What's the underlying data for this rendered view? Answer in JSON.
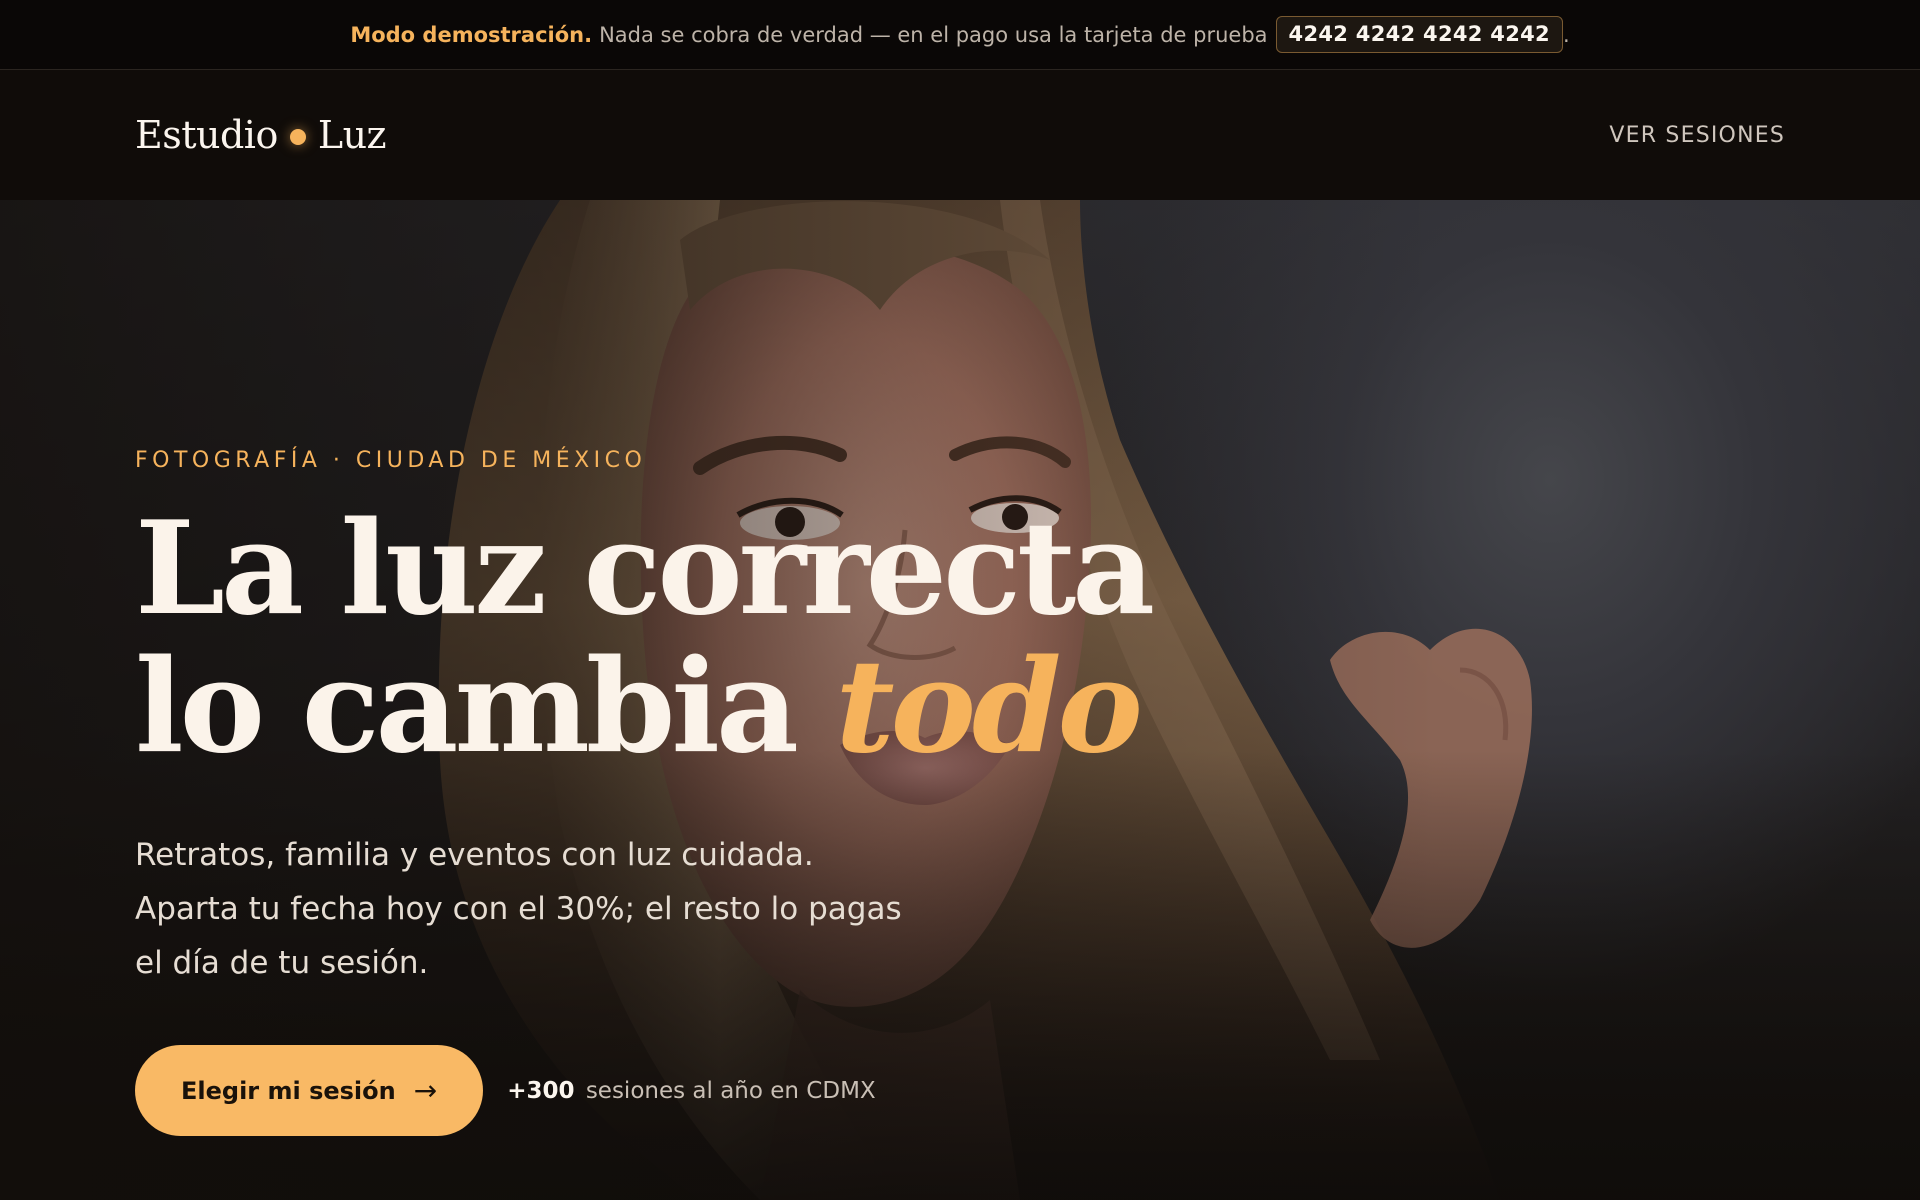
{
  "banner": {
    "highlight": "Modo demostración.",
    "message": "Nada se cobra de verdad — en el pago usa la tarjeta de prueba",
    "test_card": "4242 4242 4242 4242",
    "trailing": "."
  },
  "header": {
    "logo_left": "Estudio",
    "logo_right": "Luz",
    "nav_link": "VER SESIONES"
  },
  "hero": {
    "eyebrow": "FOTOGRAFÍA · CIUDAD DE MÉXICO",
    "headline_line1": "La luz correcta",
    "headline_line2": "lo cambia",
    "headline_accent": "todo",
    "lede": "Retratos, familia y eventos con luz cuidada. Aparta tu fecha hoy con el 30%; el resto lo pagas el día de tu sesión.",
    "cta_label": "Elegir mi sesión",
    "cta_arrow": "→",
    "proof_count": "+300",
    "proof_text": "sesiones al año en CDMX"
  },
  "icons": {
    "logo_dot": "dot-icon",
    "cta_arrow": "arrow-right-icon"
  },
  "colors": {
    "accent": "#f6b35c",
    "background": "#0f0c0a",
    "text": "#fbf3ea",
    "cta_background": "#f9b965"
  }
}
